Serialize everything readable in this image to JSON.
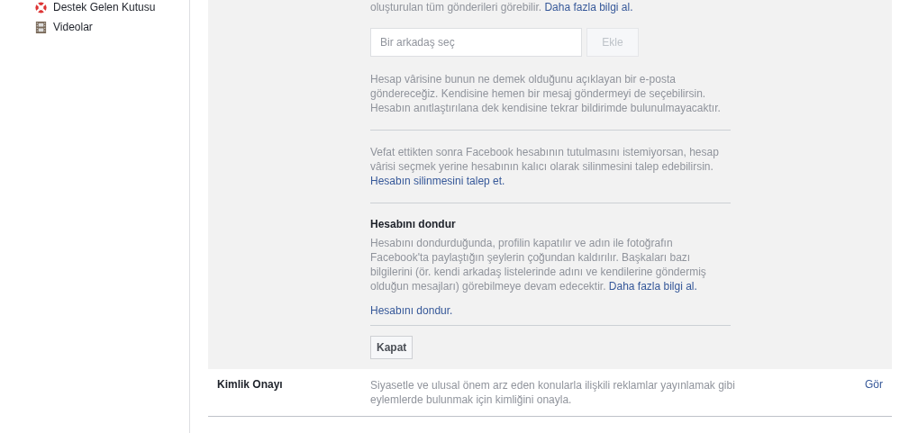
{
  "sidebar": {
    "items": [
      {
        "label": "Destek Gelen Kutusu",
        "kind": "support"
      },
      {
        "label": "Videolar",
        "kind": "video"
      }
    ]
  },
  "legacy_contact": {
    "intro_tail": "oluşturulan tüm gönderileri görebilir.",
    "intro_link": "Daha fazla bilgi al.",
    "friend_field": {
      "placeholder": "Bir arkadaş seç"
    },
    "add_button": {
      "label": "Ekle",
      "disabled": true
    },
    "note": "Hesap vârisine bunun ne demek olduğunu açıklayan bir e-posta göndereceğiz. Kendisine hemen bir mesaj göndermeyi de seçebilirsin. Hesabın anıtlaştırılana dek kendisine tekrar bildirimde bulunulmayacaktır.",
    "delete_text": "Vefat ettikten sonra Facebook hesabının tutulmasını istemiyorsan, hesap vârisi seçmek yerine hesabının kalıcı olarak silinmesini talep edebilirsin.",
    "delete_link": "Hesabın silinmesini talep et."
  },
  "deactivate": {
    "title": "Hesabını dondur",
    "text": "Hesabını dondurduğunda, profilin kapatılır ve adın ile fotoğrafın Facebook'ta paylaştığın şeylerin çoğundan kaldırılır. Başkaları bazı bilgilerini (ör. kendi arkadaş listelerinde adını ve kendilerine göndermiş olduğun mesajları) görebilmeye devam edecektir.",
    "more_link": "Daha fazla bilgi al.",
    "action_link": "Hesabını dondur."
  },
  "close_button": "Kapat",
  "identity_row": {
    "title": "Kimlik Onayı",
    "description": "Siyasetle ve ulusal önem arz eden konularla ilişkili reklamlar yayınlamak gibi eylemlerde bulunmak için kimliğini onayla.",
    "action": "Gör"
  }
}
